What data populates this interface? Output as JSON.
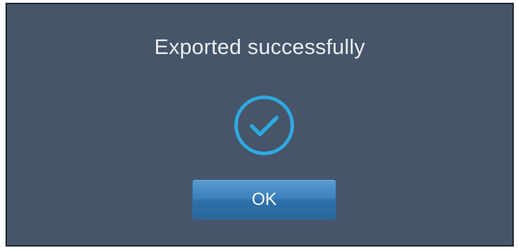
{
  "dialog": {
    "message": "Exported successfully",
    "icon": "check-circle-icon",
    "ok_label": "OK"
  },
  "colors": {
    "background": "#465569",
    "icon": "#2fa9e0",
    "button": "#3b7fbb",
    "text": "#e9edf2"
  }
}
